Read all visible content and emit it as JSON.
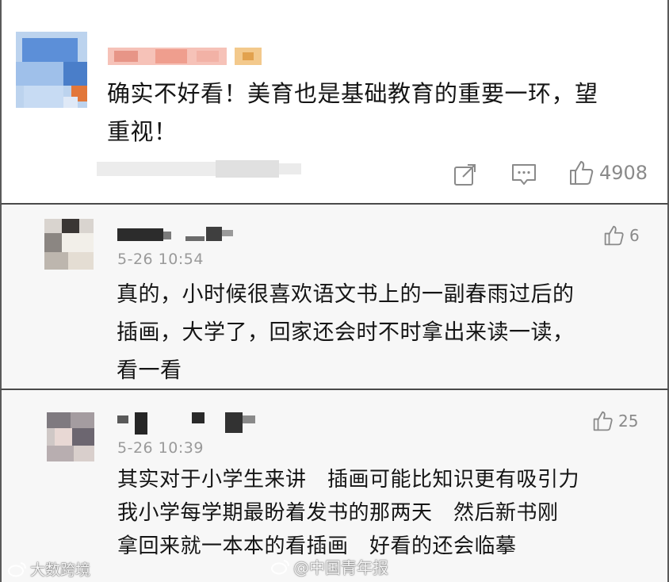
{
  "comments": [
    {
      "text": "确实不好看！美育也是基础教育的重要一环，望重视！",
      "line1": "确实不好看！美育也是基础教育的重要一环，望",
      "line2": "重视！",
      "like_count": "4908"
    },
    {
      "time": "5-26 10:54",
      "like_count": "6",
      "line1": "真的，小时候很喜欢语文书上的一副春雨过后的",
      "line2": "插画，大学了，回家还会时不时拿出来读一读，",
      "line3": "看一看"
    },
    {
      "time": "5-26 10:39",
      "like_count": "25",
      "line1": "其实对于小学生来讲　插画可能比知识更有吸引力",
      "line2": "我小学每学期最盼着发书的那两天　然后新书刚",
      "line3": "拿回来就一本本的看插画　好看的还会临摹"
    }
  ],
  "watermarks": {
    "left": "大数跨境",
    "right": "@中国青年报"
  },
  "icons": {
    "share": "share-icon",
    "comment": "comment-icon",
    "like": "thumbs-up-icon",
    "weibo": "weibo-logo-icon"
  },
  "colors": {
    "text": "#151515",
    "meta": "#9a9a9a",
    "icon": "#8a8a8a",
    "border": "#4a4a4a"
  }
}
